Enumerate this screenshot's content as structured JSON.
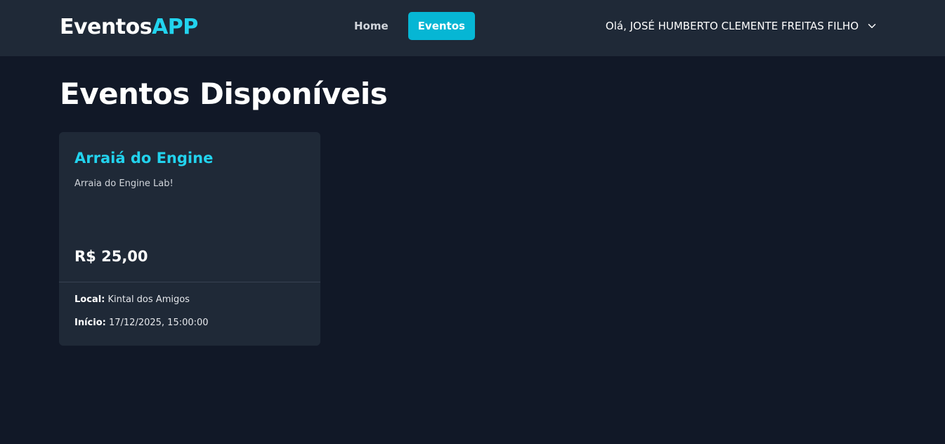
{
  "brand": {
    "part1": "Eventos",
    "part2": "APP"
  },
  "nav": {
    "items": [
      {
        "label": "Home",
        "active": false
      },
      {
        "label": "Eventos",
        "active": true
      }
    ]
  },
  "user": {
    "greeting": "Olá, JOSÉ HUMBERTO CLEMENTE FREITAS FILHO",
    "menu_icon": "chevron-down-icon"
  },
  "page": {
    "title": "Eventos Disponíveis"
  },
  "events": [
    {
      "title": "Arraiá do Engine",
      "description": "Arraia do Engine Lab!",
      "price": "R$ 25,00",
      "location_label": "Local:",
      "location": "Kintal dos Amigos",
      "start_label": "Início:",
      "start": "17/12/2025, 15:00:00"
    }
  ],
  "colors": {
    "background": "#111827",
    "navbar": "#1f2937",
    "card": "#1f2937",
    "accent": "#22d3ee",
    "active_button": "#06b6d4"
  }
}
